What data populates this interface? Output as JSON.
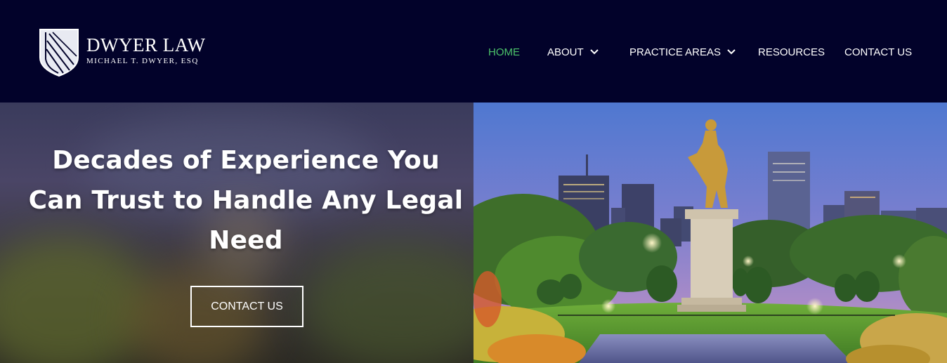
{
  "brand": {
    "title": "DWYER LAW",
    "subtitle": "MICHAEL T. DWYER, ESQ",
    "icon": "shield-logo-icon"
  },
  "nav": {
    "items": [
      {
        "label": "HOME",
        "active": true,
        "dropdown": false
      },
      {
        "label": "ABOUT",
        "active": false,
        "dropdown": true
      },
      {
        "label": "PRACTICE AREAS",
        "active": false,
        "dropdown": true
      },
      {
        "label": "RESOURCES",
        "active": false,
        "dropdown": false
      },
      {
        "label": "CONTACT US",
        "active": false,
        "dropdown": false
      }
    ]
  },
  "hero": {
    "heading": "Decades of Experience You Can Trust to Handle Any Legal Need",
    "cta_label": "CONTACT US",
    "image": "statue-park-city-skyline-photo"
  },
  "colors": {
    "header_bg": "#02022a",
    "active_nav": "#4cc46a",
    "text": "#ffffff"
  }
}
